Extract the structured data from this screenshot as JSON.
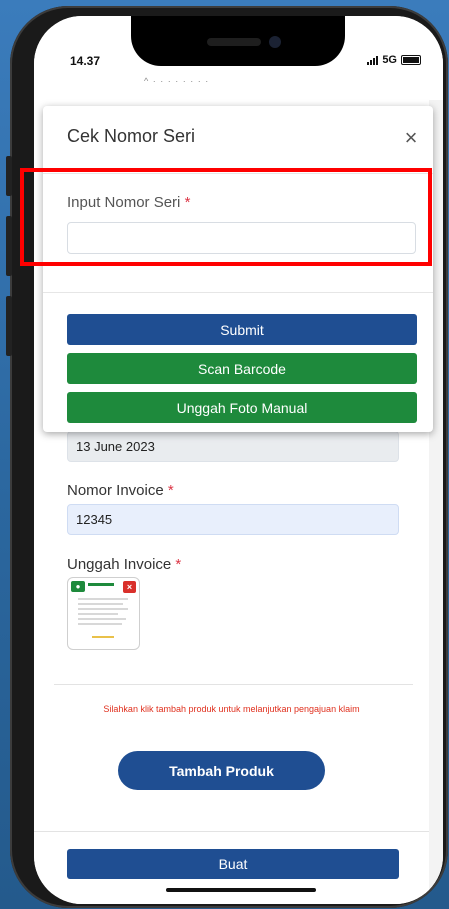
{
  "status": {
    "time": "14.37",
    "network": "5G"
  },
  "browser": {
    "url_hint": "^ · · · · · · · ·"
  },
  "page": {
    "date_value": "13 June 2023",
    "invoice_label": "Nomor Invoice",
    "invoice_value": "12345",
    "upload_label": "Unggah Invoice",
    "info_text": "Silahkan klik tambah produk untuk melanjutkan pengajuan klaim",
    "add_product_label": "Tambah Produk",
    "create_label": "Buat",
    "required_mark": "*"
  },
  "modal": {
    "title": "Cek Nomor Seri",
    "close_glyph": "×",
    "input_label": "Input Nomor Seri",
    "required_mark": "*",
    "input_value": "",
    "submit_label": "Submit",
    "scan_label": "Scan Barcode",
    "upload_photo_label": "Unggah Foto Manual"
  },
  "colors": {
    "primary": "#1f4e92",
    "success": "#1e8a3c",
    "danger": "#dc3545",
    "highlight": "#ff0000"
  }
}
